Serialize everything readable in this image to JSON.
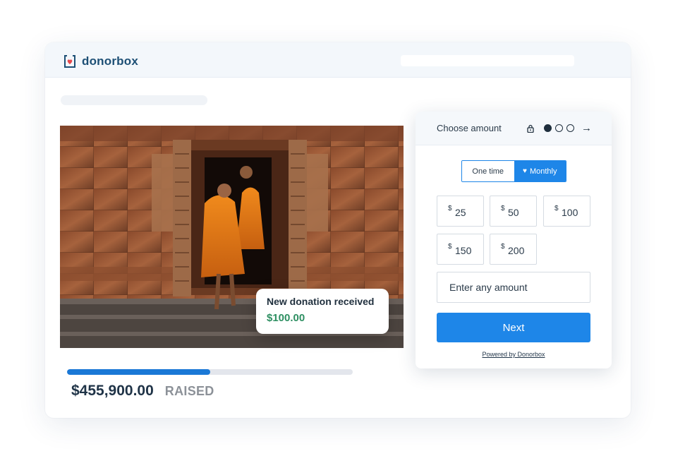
{
  "brand": {
    "name": "donorbox",
    "color": "#1d4f75"
  },
  "accent": "#1e86e8",
  "toast": {
    "title": "New donation received",
    "amount": "$100.00"
  },
  "campaign": {
    "raised_amount": "$455,900.00",
    "raised_label": "RAISED",
    "progress_fraction": 0.5
  },
  "widget": {
    "title": "Choose amount",
    "steps": {
      "total": 3,
      "current": 1
    },
    "frequency": {
      "options": [
        "One time",
        "Monthly"
      ],
      "selected": "Monthly"
    },
    "currency_symbol": "$",
    "amounts": [
      "25",
      "50",
      "100",
      "150",
      "200"
    ],
    "custom_amount_placeholder": "Enter any amount",
    "next_label": "Next",
    "powered_by": "Powered by Donorbox"
  },
  "icons": {
    "lock": "lock-icon",
    "arrow": "arrow-right-icon",
    "heart": "heart-icon",
    "logo": "donorbox-logo-icon"
  }
}
